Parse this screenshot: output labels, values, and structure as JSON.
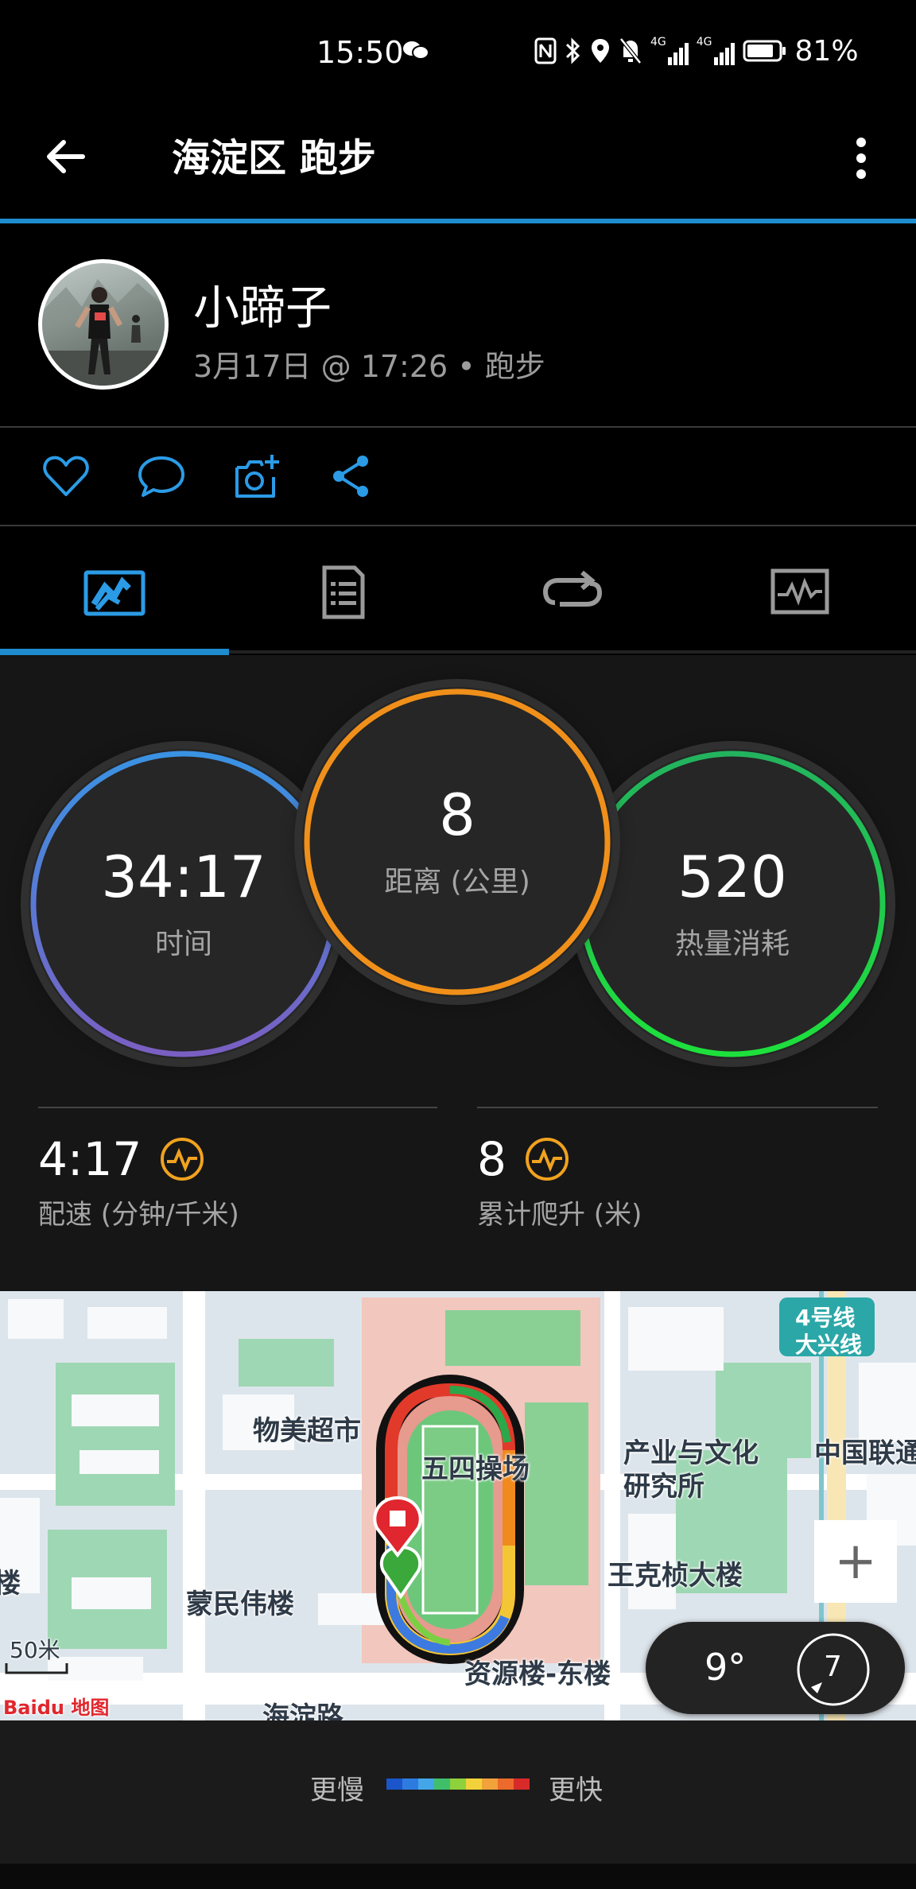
{
  "status_bar": {
    "time": "15:50",
    "battery": "81%",
    "net1": "4G",
    "net2": "4G"
  },
  "app_bar": {
    "title": "海淀区 跑步"
  },
  "profile": {
    "name": "小蹄子",
    "subline": "3月17日 @ 17:26 • 跑步"
  },
  "actions": [
    "like-icon",
    "comment-icon",
    "add-photo-icon",
    "share-icon"
  ],
  "tabs": [
    "overview-tab",
    "details-tab",
    "laps-tab",
    "charts-tab"
  ],
  "stats": {
    "time": {
      "value": "34:17",
      "label": "时间"
    },
    "distance": {
      "value": "8",
      "label": "距离 (公里)"
    },
    "calories": {
      "value": "520",
      "label": "热量消耗"
    }
  },
  "metrics": {
    "pace": {
      "value": "4:17",
      "label": "配速 (分钟/千米)"
    },
    "ascent": {
      "value": "8",
      "label": "累计爬升 (米)"
    }
  },
  "map": {
    "labels": {
      "supermarket": "物美超市",
      "stadium": "五四操场",
      "industry": "产业与文化",
      "institute": "研究所",
      "unicom": "中国联通",
      "wangkezhen": "王克桢大楼",
      "mengmin": "蒙民伟楼",
      "ziyuan": "资源楼-东楼",
      "haidian_road": "海淀路",
      "lou": "楼",
      "scale": "50米",
      "metro_line1": "4号线",
      "metro_line2": "大兴线",
      "baidu": "Baidu 地图"
    },
    "weather": {
      "temp": "9°",
      "wind": "7"
    },
    "zoom_in": "+"
  },
  "legend": {
    "slow": "更慢",
    "fast": "更快"
  },
  "colors": {
    "accent": "#1e8ccf",
    "time_ring": "#3a8fe0",
    "distance_ring": "#f0901a",
    "calories_ring": "#1ed64a",
    "badge": "#f0a21f"
  }
}
